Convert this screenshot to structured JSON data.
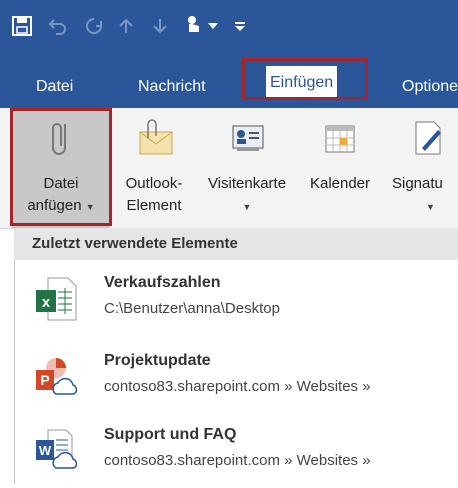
{
  "quick_access": {
    "icons": [
      "save-icon",
      "undo-icon",
      "redo-icon",
      "up-icon",
      "down-icon",
      "touch-mode-icon",
      "customize-icon"
    ]
  },
  "tabs": [
    {
      "label": "Datei"
    },
    {
      "label": "Nachricht"
    },
    {
      "label": "Einfügen",
      "active": true
    },
    {
      "label": "Optione"
    }
  ],
  "ribbon": {
    "buttons": [
      {
        "line1": "Datei",
        "line2": "anfügen",
        "icon": "paperclip-icon",
        "has_arrow": true
      },
      {
        "line1": "Outlook-",
        "line2": "Element",
        "icon": "outlook-item-icon",
        "has_arrow": false
      },
      {
        "line1": "Visitenkarte",
        "line2": "",
        "icon": "business-card-icon",
        "has_arrow": true
      },
      {
        "line1": "Kalender",
        "line2": "",
        "icon": "calendar-icon",
        "has_arrow": false
      },
      {
        "line1": "Signatu",
        "line2": "",
        "icon": "signature-icon",
        "has_arrow": true
      }
    ]
  },
  "menu": {
    "header": "Zuletzt verwendete Elemente",
    "items": [
      {
        "title": "Verkaufszahlen",
        "path": "C:\\Benutzer\\anna\\Desktop",
        "icon": "excel-file-icon"
      },
      {
        "title": "Projektupdate",
        "path": "contoso83.sharepoint.com » Websites »",
        "icon": "powerpoint-cloud-icon"
      },
      {
        "title": "Support und FAQ",
        "path": "contoso83.sharepoint.com » Websites »",
        "icon": "word-cloud-icon"
      }
    ]
  },
  "colors": {
    "title_bar": "#2b579a",
    "highlight": "#a4262c",
    "ribbon_bg": "#f3f3f3",
    "excel": "#217346",
    "powerpoint": "#d24726",
    "word": "#2b579a"
  }
}
